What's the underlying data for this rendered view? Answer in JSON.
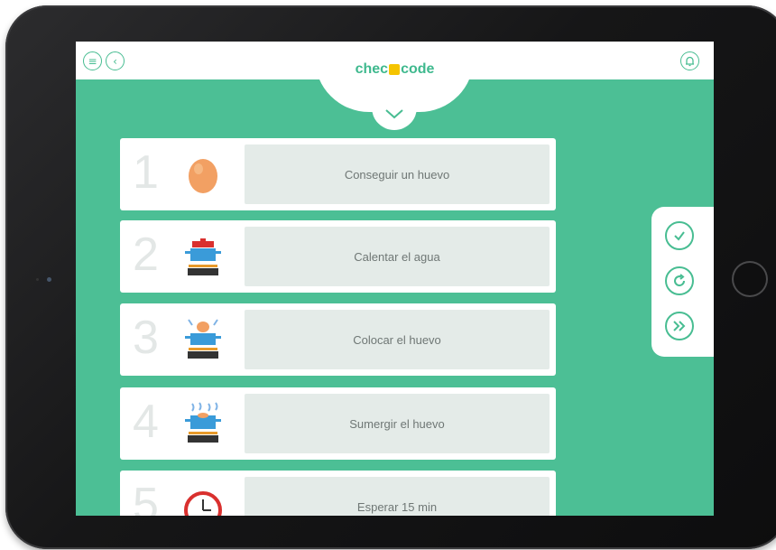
{
  "app": {
    "logo_text_left": "chec",
    "logo_text_right": "code",
    "accent_color": "#4cbf95"
  },
  "header": {
    "icons": [
      "menu-icon",
      "back-icon",
      "bell-icon"
    ],
    "dropdown_icon": "chevron-down-icon"
  },
  "steps": [
    {
      "number": "1",
      "label": "Conseguir un huevo",
      "icon": "egg-icon"
    },
    {
      "number": "2",
      "label": "Calentar el agua",
      "icon": "pot-on-stove-icon"
    },
    {
      "number": "3",
      "label": "Colocar el huevo",
      "icon": "egg-into-pot-icon"
    },
    {
      "number": "4",
      "label": "Sumergir el huevo",
      "icon": "boiling-egg-icon"
    },
    {
      "number": "5",
      "label": "Esperar 15 min",
      "icon": "clock-icon"
    }
  ],
  "side_panel": {
    "buttons": [
      "check-icon",
      "restart-icon",
      "fast-forward-icon"
    ]
  }
}
